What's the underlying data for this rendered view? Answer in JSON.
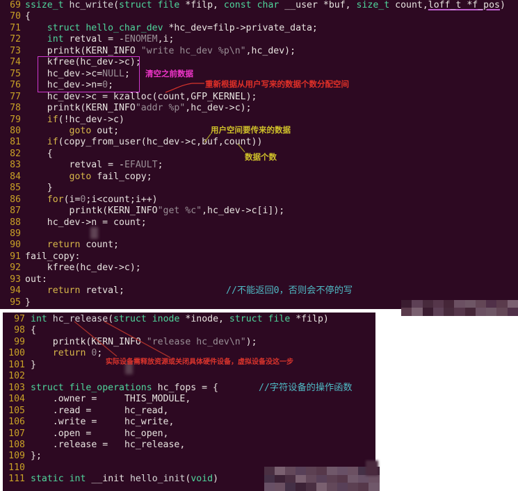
{
  "screenshot": {
    "title": "Linux char device driver source code with annotations",
    "background": "#2d0922",
    "line_number_color": "#c9a227"
  },
  "panels": [
    {
      "name": "top-panel",
      "lines": [
        {
          "n": "69",
          "text": "ssize_t hc_write(struct file *filp, const char __user *buf, size_t count,loff_t *f_pos)"
        },
        {
          "n": "70",
          "text": "{"
        },
        {
          "n": "71",
          "text": "    struct hello_char_dev *hc_dev=filp->private_data;"
        },
        {
          "n": "72",
          "text": "    int retval = -ENOMEM,i;"
        },
        {
          "n": "73",
          "text": "    printk(KERN_INFO \"write hc_dev %p\\n\",hc_dev);"
        },
        {
          "n": "74",
          "text": "    kfree(hc_dev->c);"
        },
        {
          "n": "75",
          "text": "    hc_dev->c=NULL;"
        },
        {
          "n": "76",
          "text": "    hc_dev->n=0;"
        },
        {
          "n": "77",
          "text": "    hc_dev->c = kzalloc(count,GFP_KERNEL);"
        },
        {
          "n": "78",
          "text": "    printk(KERN_INFO\"addr %p\",hc_dev->c);"
        },
        {
          "n": "79",
          "text": "    if(!hc_dev->c)"
        },
        {
          "n": "80",
          "text": "        goto out;"
        },
        {
          "n": "81",
          "text": "    if(copy_from_user(hc_dev->c,buf,count))"
        },
        {
          "n": "82",
          "text": "    {"
        },
        {
          "n": "83",
          "text": "        retval = -EFAULT;"
        },
        {
          "n": "84",
          "text": "        goto fail_copy;"
        },
        {
          "n": "85",
          "text": "    }"
        },
        {
          "n": "86",
          "text": "    for(i=0;i<count;i++)"
        },
        {
          "n": "87",
          "text": "        printk(KERN_INFO\"get %c\",hc_dev->c[i]);"
        },
        {
          "n": "88",
          "text": "    hc_dev->n = count;"
        },
        {
          "n": "89",
          "text": ""
        },
        {
          "n": "90",
          "text": "    return count;"
        },
        {
          "n": "91",
          "text": "fail_copy:"
        },
        {
          "n": "92",
          "text": "    kfree(hc_dev->c);"
        },
        {
          "n": "93",
          "text": "out:"
        },
        {
          "n": "94",
          "text": "    return retval;"
        },
        {
          "n": "95",
          "text": "}"
        }
      ]
    },
    {
      "name": "bottom-panel",
      "lines": [
        {
          "n": "97",
          "text": "int hc_release(struct inode *inode, struct file *filp)"
        },
        {
          "n": "98",
          "text": "{"
        },
        {
          "n": "99",
          "text": "    printk(KERN_INFO \"release hc_dev\\n\");"
        },
        {
          "n": "100",
          "text": "    return 0;"
        },
        {
          "n": "101",
          "text": "}"
        },
        {
          "n": "102",
          "text": ""
        },
        {
          "n": "103",
          "text": "struct file_operations hc_fops = {"
        },
        {
          "n": "104",
          "text": "    .owner =     THIS_MODULE,"
        },
        {
          "n": "105",
          "text": "    .read =      hc_read,"
        },
        {
          "n": "106",
          "text": "    .write =     hc_write,"
        },
        {
          "n": "107",
          "text": "    .open =      hc_open,"
        },
        {
          "n": "108",
          "text": "    .release =   hc_release,"
        },
        {
          "n": "109",
          "text": "};"
        },
        {
          "n": "110",
          "text": ""
        },
        {
          "n": "111",
          "text": "static int __init hello_init(void)"
        }
      ]
    }
  ],
  "annotations": {
    "clear_previous_data": "清空之前数据",
    "reallocate_by_count": "重新根据从用户写来的数据个数分配空间",
    "user_space_data": "用户空间要传来的数据",
    "data_count": "数据个数",
    "cannot_return_zero": "//不能返回0，否则会不停的写",
    "release_resources": "实际设备需释放资源或关闭具体硬件设备，虚拟设备没这一步",
    "char_device_ops": "//字符设备的操作函数"
  },
  "colors": {
    "highlight_box": "#d03ad0",
    "magenta_note": "#ee35c8",
    "red_note": "#e03028",
    "yellow_note": "#cfc02a",
    "comment_cyan": "#4fb9c4"
  }
}
